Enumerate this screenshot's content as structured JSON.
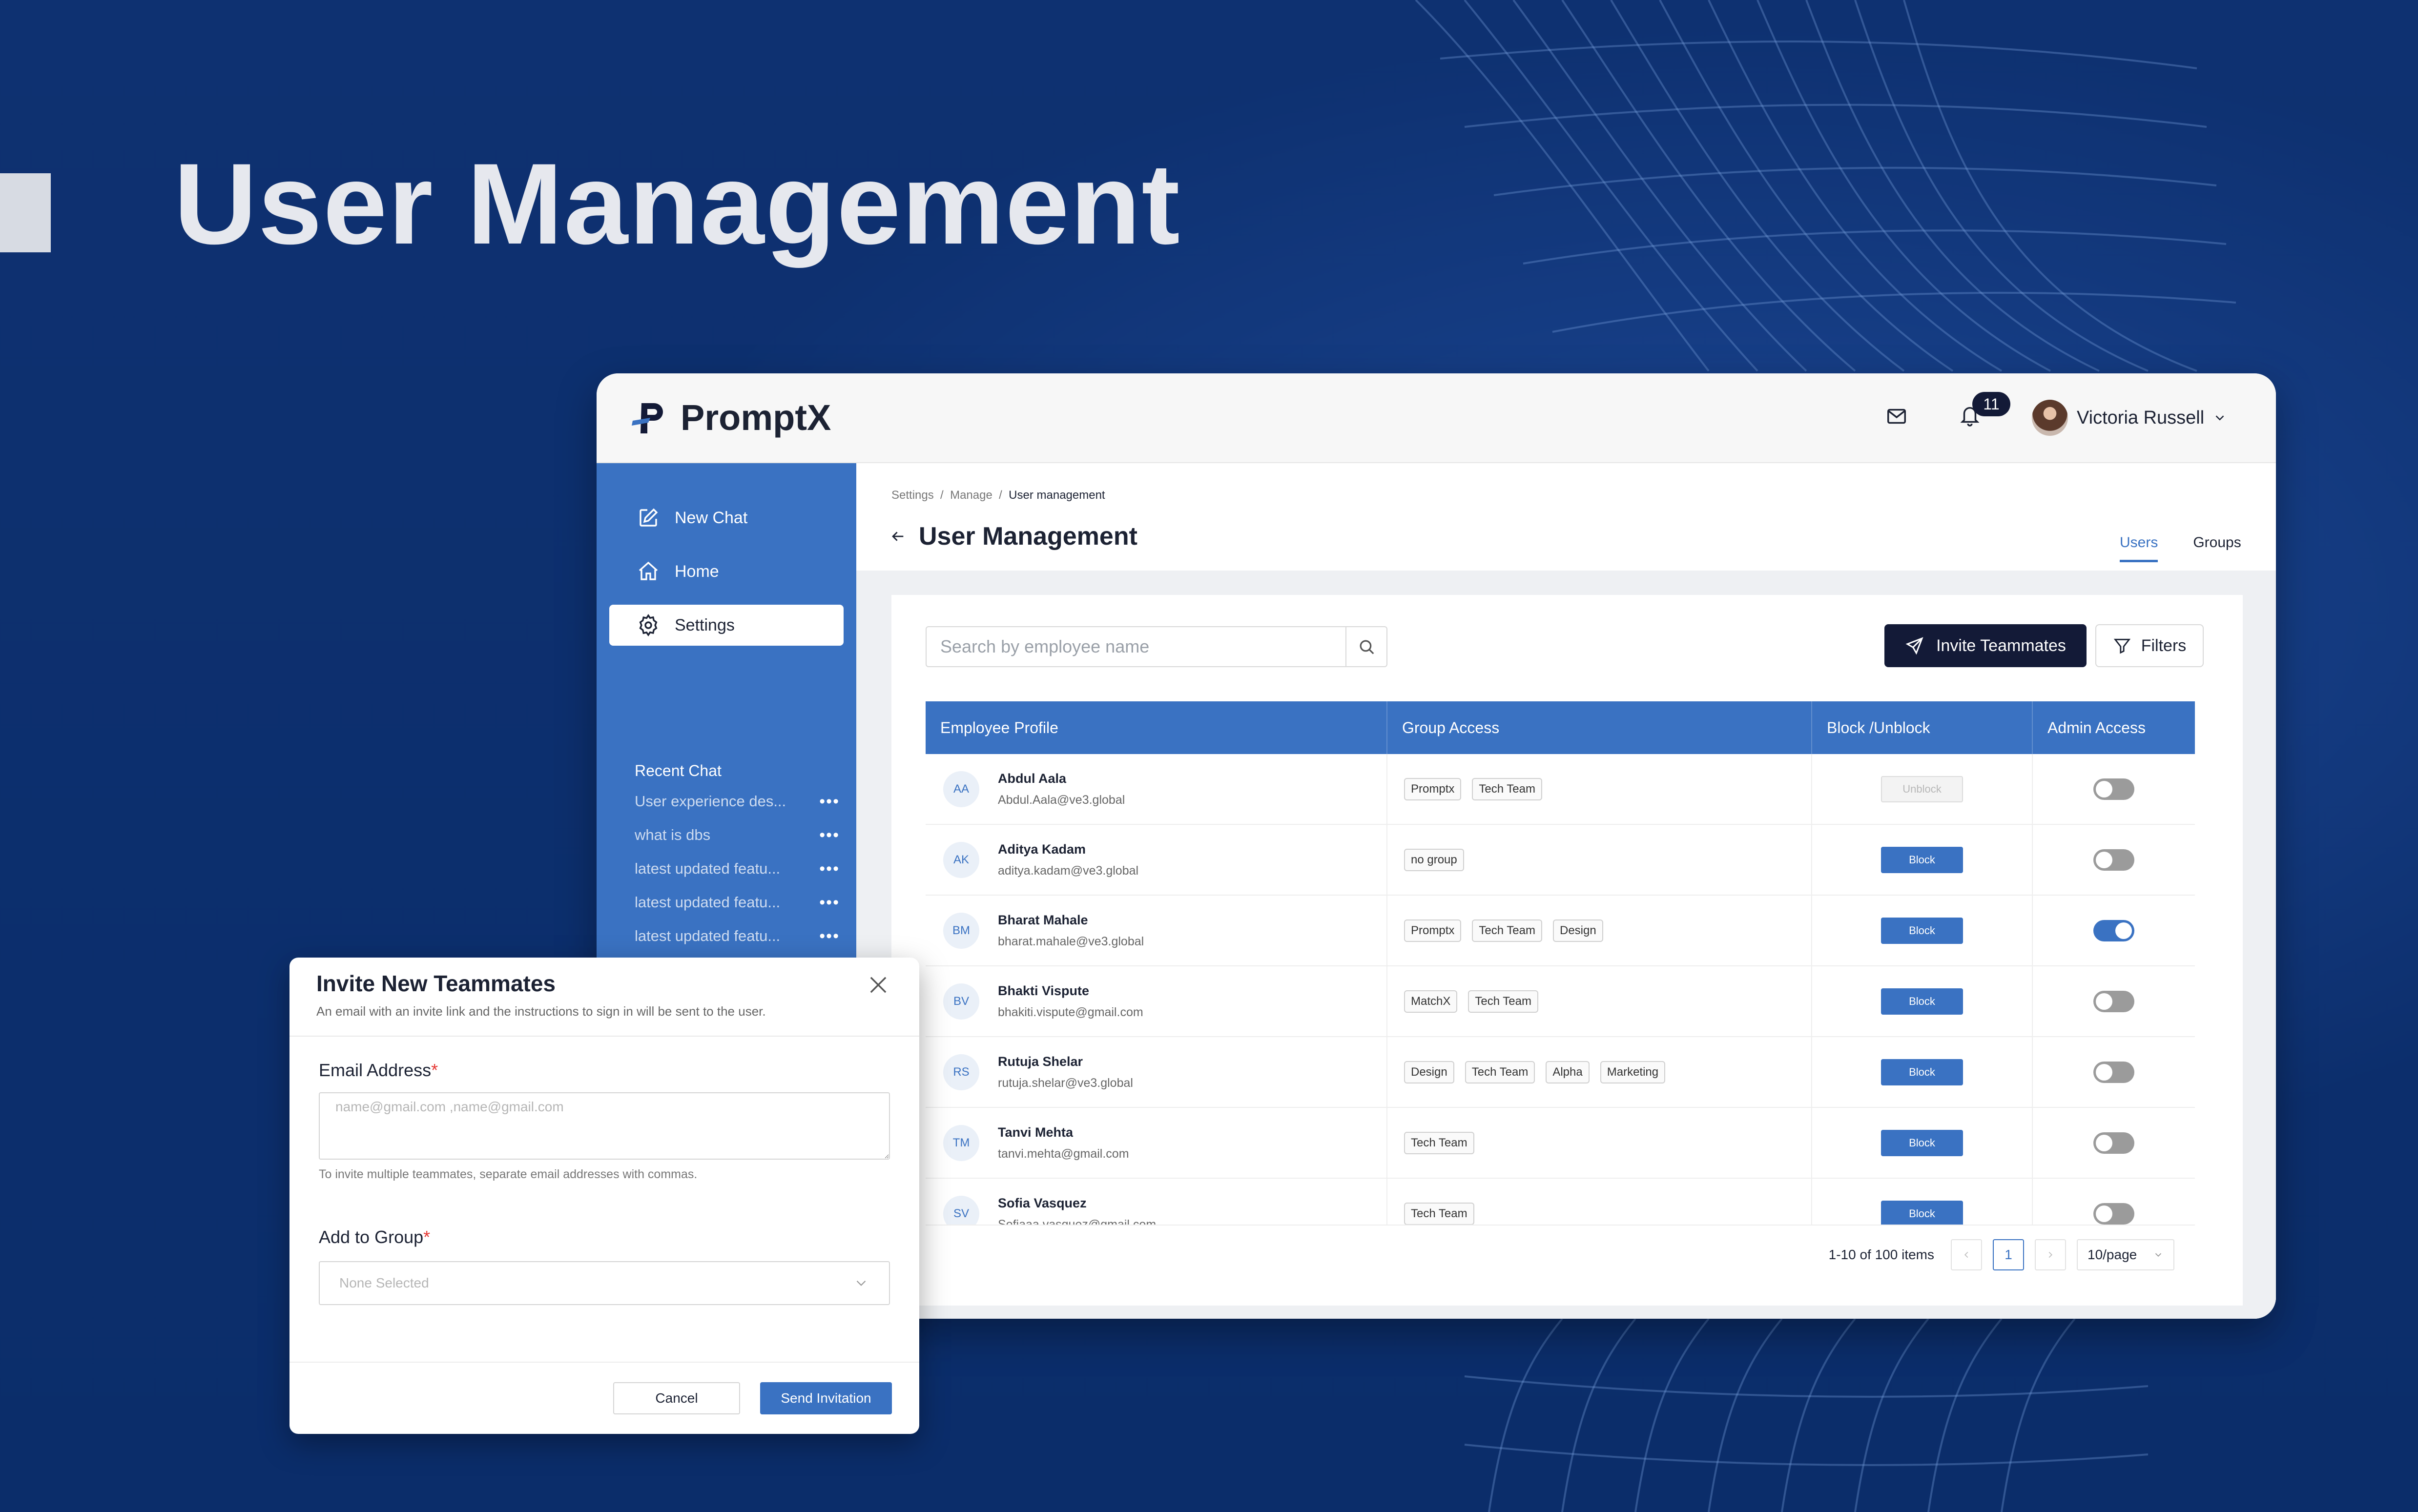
{
  "hero": {
    "title": "User Management"
  },
  "colors": {
    "background": "#0d3070",
    "accent": "#3a72c2",
    "dark_button": "#131a37"
  },
  "topbar": {
    "logo_text": "PromptX",
    "mail_icon": "mail-icon",
    "notification_count": "11",
    "user_name": "Victoria Russell"
  },
  "sidebar": {
    "items": [
      {
        "label": "New Chat",
        "icon": "new-chat-icon"
      },
      {
        "label": "Home",
        "icon": "home-icon"
      },
      {
        "label": "Settings",
        "icon": "gear-icon",
        "active": true
      }
    ],
    "recent_title": "Recent Chat",
    "recent": [
      "User experience des...",
      "what is dbs",
      "latest updated featu...",
      "latest updated featu...",
      "latest updated featu..."
    ]
  },
  "main": {
    "breadcrumb": [
      "Settings",
      "Manage",
      "User management"
    ],
    "title": "User Management",
    "tabs": [
      "Users",
      "Groups"
    ],
    "search_placeholder": "Search by employee name",
    "invite_button": "Invite Teammates",
    "filter_button": "Filters",
    "columns": [
      "Employee Profile",
      "Group Access",
      "Block /Unblock",
      "Admin Access"
    ],
    "rows": [
      {
        "initials": "AA",
        "name": "Abdul Aala",
        "email": "Abdul.Aala@ve3.global",
        "groups": [
          "Promptx",
          "Tech Team"
        ],
        "action": "Unblock",
        "admin": false
      },
      {
        "initials": "AK",
        "name": "Aditya Kadam",
        "email": "aditya.kadam@ve3.global",
        "groups": [
          "no group"
        ],
        "action": "Block",
        "admin": false
      },
      {
        "initials": "BM",
        "name": "Bharat Mahale",
        "email": "bharat.mahale@ve3.global",
        "groups": [
          "Promptx",
          "Tech Team",
          "Design"
        ],
        "action": "Block",
        "admin": true
      },
      {
        "initials": "BV",
        "name": "Bhakti Vispute",
        "email": "bhakiti.vispute@gmail.com",
        "groups": [
          "MatchX",
          "Tech Team"
        ],
        "action": "Block",
        "admin": false
      },
      {
        "initials": "RS",
        "name": "Rutuja Shelar",
        "email": "rutuja.shelar@ve3.global",
        "groups": [
          "Design",
          "Tech Team",
          "Alpha",
          "Marketing"
        ],
        "action": "Block",
        "admin": false
      },
      {
        "initials": "TM",
        "name": "Tanvi Mehta",
        "email": "tanvi.mehta@gmail.com",
        "groups": [
          "Tech Team"
        ],
        "action": "Block",
        "admin": false
      },
      {
        "initials": "SV",
        "name": "Sofia Vasquez",
        "email": "Sofiaaa.vasquez@gmail.com",
        "groups": [
          "Tech Team"
        ],
        "action": "Block",
        "admin": false
      }
    ],
    "pagination": {
      "summary": "1-10 of 100 items",
      "current_page": "1",
      "page_size": "10/page"
    }
  },
  "modal": {
    "title": "Invite New Teammates",
    "subtitle": "An email with an invite link and the instructions to sign in will be sent to the user.",
    "email_label": "Email Address",
    "email_placeholder": "name@gmail.com ,name@gmail.com",
    "email_hint": "To invite multiple teammates, separate email addresses with commas.",
    "group_label": "Add to Group",
    "group_placeholder": "None Selected",
    "required_mark": "*",
    "cancel": "Cancel",
    "send": "Send Invitation"
  }
}
